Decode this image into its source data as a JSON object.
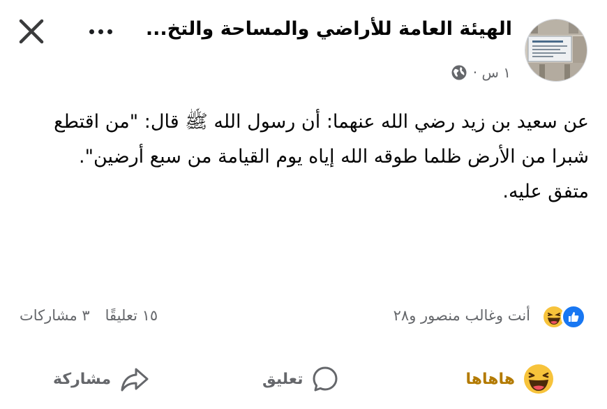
{
  "header": {
    "page_name": "الهيئة العامة للأراضي والمساحة والتخ...",
    "time": "١ س ·",
    "icons": {
      "close": "close-icon",
      "more": "more-dots-icon",
      "privacy": "globe-icon"
    }
  },
  "post": {
    "paragraphs": [
      "عن سعيد بن زيد رضي الله عنهما: أن رسول الله ﷺ قال: \"من اقتطع شبرا من الأرض ظلما طوقه الله إياه يوم القيامة من سبع أرضين\".",
      "متفق عليه."
    ]
  },
  "stats": {
    "reactors": "أنت وغالب منصور و٢٨",
    "comments": "١٥ تعليقًا",
    "shares": "٣ مشاركات",
    "reaction_icons": [
      "like-reaction-icon",
      "haha-reaction-icon"
    ]
  },
  "actions": {
    "haha_label": "هاهاها",
    "comment_label": "تعليق",
    "share_label": "مشاركة"
  },
  "colors": {
    "like_blue": "#1877f2",
    "haha_yellow": "#f7c33b",
    "haha_text": "#b37a00",
    "secondary_text": "#65676b"
  }
}
